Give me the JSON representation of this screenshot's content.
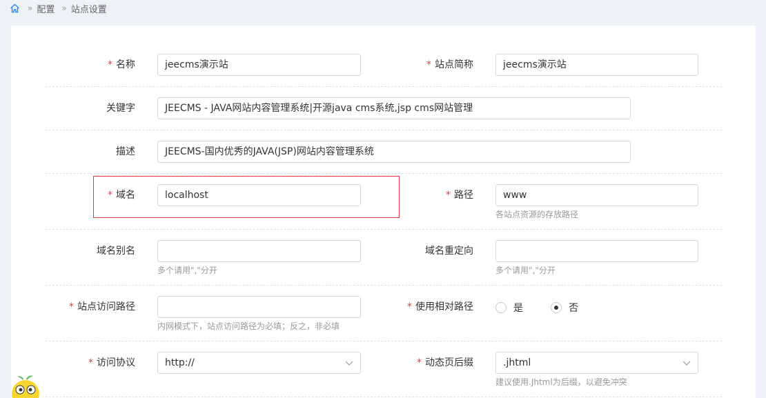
{
  "breadcrumb": {
    "home_icon": "home-icon",
    "items": [
      "配置",
      "站点设置"
    ],
    "separator": "»"
  },
  "form": {
    "name": {
      "label": "名称",
      "required": true,
      "value": "jeecms演示站"
    },
    "short_name": {
      "label": "站点简称",
      "required": true,
      "value": "jeecms演示站"
    },
    "keywords": {
      "label": "关键字",
      "required": false,
      "value": "JEECMS - JAVA网站内容管理系统|开源java cms系统,jsp cms网站管理"
    },
    "description": {
      "label": "描述",
      "required": false,
      "value": "JEECMS-国内优秀的JAVA(JSP)网站内容管理系统"
    },
    "domain": {
      "label": "域名",
      "required": true,
      "value": "localhost"
    },
    "path": {
      "label": "路径",
      "required": true,
      "value": "www",
      "hint": "各站点资源的存放路径"
    },
    "domain_alias": {
      "label": "域名别名",
      "required": false,
      "value": "",
      "hint": "多个请用\",\"分开"
    },
    "domain_redirect": {
      "label": "域名重定向",
      "required": false,
      "value": "",
      "hint": "多个请用\",\"分开"
    },
    "access_path": {
      "label": "站点访问路径",
      "required": true,
      "value": "",
      "hint": "内网模式下，站点访问路径为必填；反之，非必填"
    },
    "relative_path": {
      "label": "使用相对路径",
      "required": true,
      "options": [
        "是",
        "否"
      ],
      "selected": "否"
    },
    "protocol": {
      "label": "访问协议",
      "required": true,
      "value": "http://"
    },
    "dynamic_suffix": {
      "label": "动态页后缀",
      "required": true,
      "value": ".jhtml",
      "hint": "建议使用.Jhtml为后缀，以避免冲突"
    }
  },
  "colors": {
    "required_star": "#e63c3c",
    "highlight_border": "#e0303a",
    "home_icon": "#2d8cf0"
  }
}
